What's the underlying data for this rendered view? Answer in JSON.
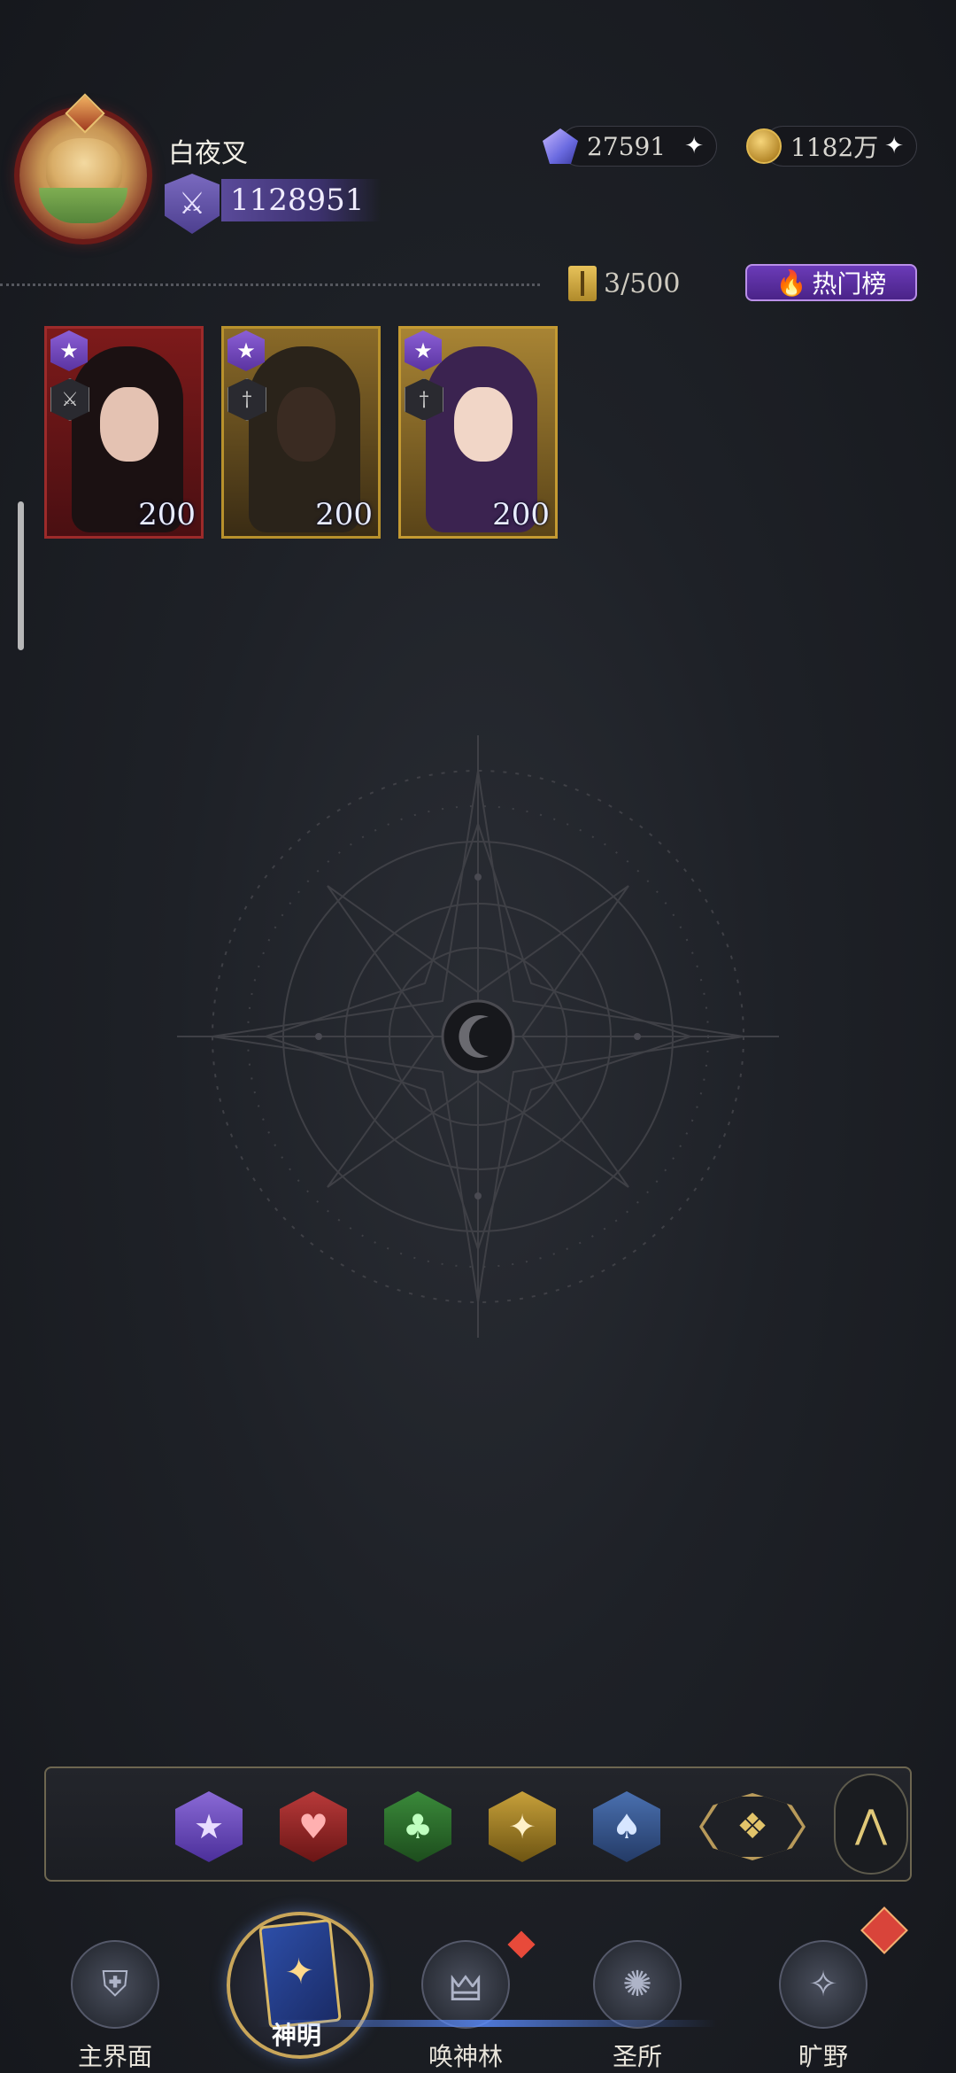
{
  "player": {
    "name": "白夜叉",
    "power": "1128951",
    "badge_icon": "crossed-swords-icon"
  },
  "currencies": {
    "crystal": {
      "icon": "crystal-star-icon",
      "value": "27591",
      "add": "+"
    },
    "gold": {
      "icon": "gold-coin-icon",
      "value": "1182万",
      "add": "+"
    }
  },
  "collection": {
    "count": "3/500",
    "hot_button": "热门榜"
  },
  "cards": [
    {
      "level": "200",
      "rank_icon": "star-icon",
      "role_icon": "swords-icon",
      "frame_color": "#9c2a2a"
    },
    {
      "level": "200",
      "rank_icon": "star-icon",
      "role_icon": "dagger-icon",
      "frame_color": "#b8912c"
    },
    {
      "level": "200",
      "rank_icon": "star-icon",
      "role_icon": "dagger-icon",
      "frame_color": "#c49a32"
    }
  ],
  "filters": [
    {
      "name": "star",
      "glyph": "★",
      "selected": true
    },
    {
      "name": "heart",
      "glyph": "♥"
    },
    {
      "name": "club",
      "glyph": "♣"
    },
    {
      "name": "diamond",
      "glyph": "✦"
    },
    {
      "name": "spade",
      "glyph": "♠"
    },
    {
      "name": "all",
      "glyph": "❖"
    }
  ],
  "collapse_glyph": "⋀",
  "nav": {
    "home": "主界面",
    "gods": "神明",
    "forest": "唤神林",
    "sanctuary": "圣所",
    "wild": "旷野",
    "active": "gods"
  },
  "colors": {
    "accent_gold": "#c9a65a",
    "accent_purple": "#6b3bb8",
    "background": "#1e2127"
  }
}
